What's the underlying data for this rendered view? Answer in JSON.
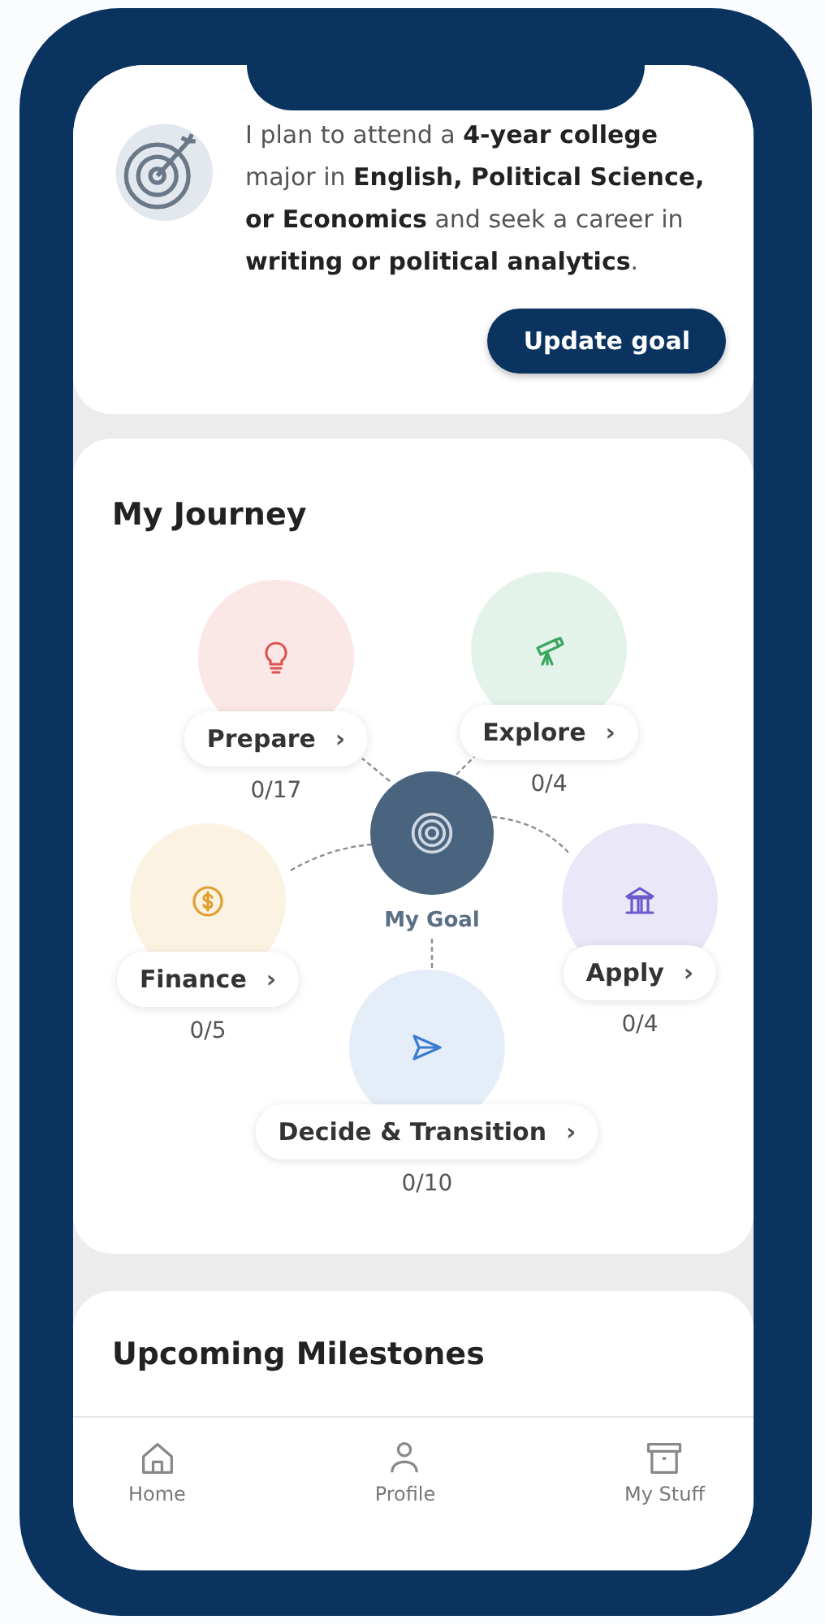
{
  "goal_card": {
    "text": "I plan to attend a **4-year college** major in **English, Political Science,** **or Economics** and seek a career in **writing or political analytics**.",
    "button": "Update goal"
  },
  "journey": {
    "title": "My Journey",
    "center_label": "My Goal",
    "nodes": [
      {
        "label": "Prepare",
        "chevron": "›",
        "count": "0/17",
        "color": "#d9534f"
      },
      {
        "label": "Explore",
        "chevron": "›",
        "count": "0/4",
        "color": "#3aa660"
      },
      {
        "label": "Finance",
        "chevron": "›",
        "count": "0/5",
        "color": "#e0a030"
      },
      {
        "label": "Apply",
        "chevron": "›",
        "count": "0/4",
        "color": "#6a5acd"
      },
      {
        "label": "Decide & Transition",
        "chevron": "›",
        "count": "0/10",
        "color": "#3b7bd0"
      }
    ]
  },
  "milestones": {
    "title": "Upcoming Milestones"
  },
  "nav": [
    {
      "label": "Home"
    },
    {
      "label": "Profile"
    },
    {
      "label": "My Stuff"
    }
  ]
}
